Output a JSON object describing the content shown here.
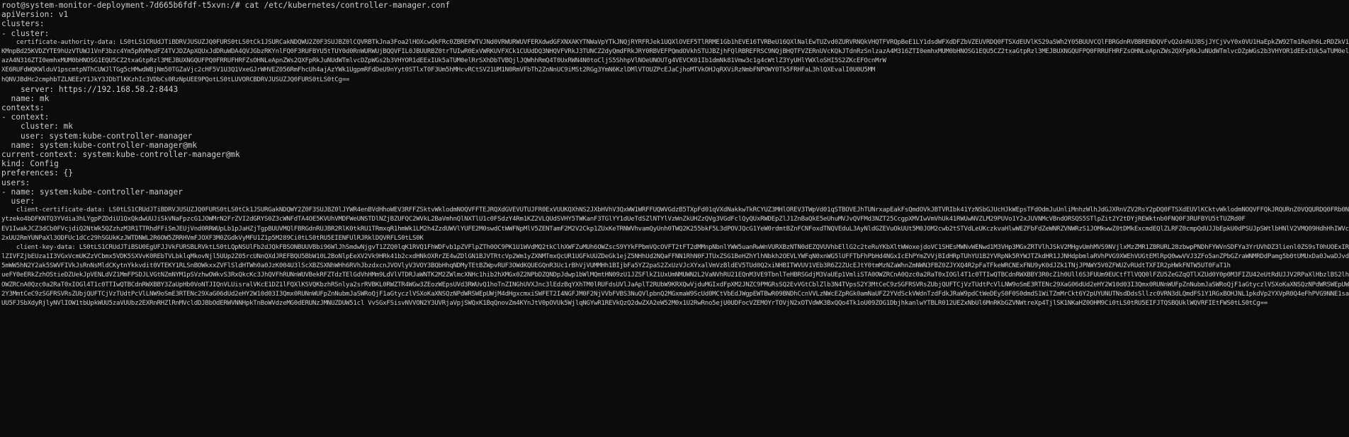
{
  "terminal": {
    "lines": [
      {
        "text": "root@system-monitor-deployment-7d665b6fdf-t5xvn:/# cat /etc/kubernetes/controller-manager.conf"
      },
      {
        "text": "apiVersion: v1"
      },
      {
        "text": "clusters:"
      },
      {
        "text": "- cluster:"
      },
      {
        "blob": true,
        "text": "    certificate-authority-data: LS0tLS1CRUdJTiBDRVJUSUZJQ0FURS0tLS0tCk1JSURCakNDQWU2Z0F3SUJBZ0lCQVRBTkJna3Foa2lHOXcwQkFRc0ZBREFWTVJNd0VRWURWUVFERXdwdGFXNXAKYTNWaVpYTkJNQjRYRFRJek1UQXlOVEF5TlRRME1Gb1hEVE16TVRBeU16QXlNalEwTUZvd0ZURVRNQkVHQTFVRQpBeE1LY1dsdWFXdDFZbVZEUVRDQ0FTSXdEUVlKS29aSWh2Y05BUUVCQlFBRGdnRVBBRENDQVFvQ2dnRUJBSjJYCjVvY0x0VU1HaEpkZW92Tm1ReUh6LzRDZkV1ejcwZEtveUlETENDazVkV09nY05zb2c5K1M2RCtHNlBMZUFRRk1UKV0NMV29icUVGREx0amtvSVEzSWRyV1loUkpzWXdOdU1uOWQ0eWxyS05RVXIwbm1kdVAzd2ZJS3BvMHpNdi9NZ"
      },
      {
        "blob": true,
        "text": "KMnpBd25KVDZYTE9hUzVTUWJ1VnF3bzc4Ym5pRVMvdFZ4TVJDZApXQUxJdDRuWDA4QVJGbzRKYnlFQ0F3RUFBYU5tTUY0d0RnWURWUjBQQVFIL0JBUURBZ0trTUIwR0ExVWRKUVFXCk1CUUdDQ3NHQVFVRkJ3TUNCZ2dyQmdFRkJRY0RBVEFPQmdOVkhSTUJBZjhFQlRBREFRSC9NQjBHQTFVZERnUVcKQkJTdnRzSnlzazA4M316ZTI0emhxMUM0bHNOSG1EQU5CZ2txaGtpRzl3MEJBUXNGQUFPQ0FRRUFHRFZsOHNLeApnZWs2QXFpRkJuNUdWTmlvcDZpWGs2b3VHYOR1dEExIUk5aTUM0elRrSXhDbTVBQjlJQWhhRmQ4T0UxRWN4N0toCljIjRnQ2dWN0toCl"
      },
      {
        "blob": true,
        "text": "azA4N316ZTI0emhxMUM0bHNOSG1EQU5CZ2txaGtpRzl3MEJBUXNGQUFPQ0FRRUFHRFZsOHNLeApnZWs2QXFpRkJuNUdWTmlvcDZpWGs2b3VHYOR1dEExIUk5aTUM0elRrSXhDbTVBQjlJQWhhRmQ4T0UxRWN4N0toCljS5ShhpVlNOeUNOUTg4VEVCK01Ib1dmNk81Vmw3c1g4cWtlZ3YyUHlYWXloSHI5S2ZKcEFOcnMrW"
      },
      {
        "blob": true,
        "text": "XE6RUFdWQKWlduV1pscmtpNThCUWJlTGg5cHMwdWBjNm50TGZaVjc2cHF5V1U3Q1VxeGJrWHVEZ056RmFhcUh4ajAzYWk1UgpmRFdDeU9nYyt0STlxT0F3Um5hMHcvRCtSV21UM1N0RmVFbTh2ZnNnUC9iMSt2RGg3YmN6KzlDMlVTOUZPcEJaCjhoMTVkOHJqRXViRzNmbFNPOWY0Tk5FRHFaL3hlQXEvalI0U0U5MM"
      },
      {
        "blob": true,
        "text": "hQNVJBdHc2cmphbTZLNEEzY1JkY3JDbTlKKzhIc3VDbCs0RzNpUEE9PQotLS0tLUVORCBDRVJUSUZJQ0FURS0tLS0tCg=="
      },
      {
        "text": "    server: https://192.168.58.2:8443"
      },
      {
        "text": "  name: mk"
      },
      {
        "text": "contexts:"
      },
      {
        "text": "- context:"
      },
      {
        "text": "    cluster: mk"
      },
      {
        "text": "    user: system:kube-controller-manager"
      },
      {
        "text": "  name: system:kube-controller-manager@mk"
      },
      {
        "text": "current-context: system:kube-controller-manager@mk"
      },
      {
        "text": "kind: Config"
      },
      {
        "text": "preferences: {}"
      },
      {
        "text": "users:"
      },
      {
        "text": "- name: system:kube-controller-manager"
      },
      {
        "text": "  user:"
      },
      {
        "blob": true,
        "text": "    client-certificate-data: LS0tLS1CRUdJTiBDRVJUSUZJQ0FURS0tLS0tCk1JSURGakNDQWY2Z0F3SUJBZ0lJYWR4enBVdHhoWEV3RFFZSktvWklodmNOQVFFTEJRQXdGVEVUTUJFR0ExVUUKQXhNS2JXbHVhV3QxWW1WRFFUQWVGdzB5TXpFd01qVXdNakkwTkRCYUZ3MHlOREV3TWpVd01qSTBOVEJhTUNrxapEakFsQmdOVkJBTVRIbk41YzNSbGJUcHJkWEpsTFdOdmJuUnliMnhzWlhJdGJXRnVZV2RsY2pDQ0FTSXdEUVlKCktvWklodmNOQVFFQkJRQURnZ0VQQURDQ0FRb0NnZ0VCQUovcWJ2ZVI4TFhWeUFMVnpWNzZlK2lvWndkekpNQjN6VVBkSUN2"
      },
      {
        "blob": true,
        "text": "ytzeko4bDFKNTQ3YVdia3hLYgpPZDdiU1QxQkdwUUJiSkVNaFpzcG1JOWMrN2FrZVI2dGRYS0Z3cWNFdTA4OE5KVUhVMDFWeUNSTDlNZjBZUFQC2WVkL2BaVmhnQlNXTlU1c0FSdzY4Rm1KZ2VLQUdSVHY5TWKanF3TGlYY1dUeTdSZlNTYlVzWnZkUHZzQVg3VGdFclQyQUxRWDEpZlJ1ZnBaQkE5eUhuMVJvQVFMd3NZT25CcgpXMVIwVmVhUk41RWUwNVZLM29PUVo1Y2xJUVNMcVBndORSQS5STlpZit2Y2tDYjREWktnb0FNQ0F3RUFBYU5tTUZRd0F"
      },
      {
        "blob": true,
        "text": "EV1IwakJCZ3dCb0FVcjdiQ2NtWk5QZzhzM3R1TTRhdFFiSmJEUjVnd0RRWUpLb1pJaHZjTgpBUUVMQlFBRGdnRUJBR2RlK0tkRU1TRmxqR1hmWk1LM2h4ZzdUWVlYUFE2M0swdCtWWFNpMlV5ZENTamF2M2V2Ckp1ZUxKeTRNWVhvamQyUnh0TWQ2K255bkF5L3dPOVJQcG1YeW0rdmtBZnFCNFoxdTNQVEduL3AyNldGZEVuOkUUt5M0JOM2cwb2tSTVdLeUKczkvaHlwWEZFbFdZeWNRZVNWRzS1JOMkwwZ0tDMkExcmdEQlZLRFZ0cmpQdUJJbEpkU0dPSUJpSWtlbHNlV2VMQ09HdhHhIWVc5VFBvaGNTL2xsNHlEeiZDZFIzSnBxSmdwQlRJRkd"
      },
      {
        "blob": true,
        "text": "2xUU2RmYUNPaXl3ODFUc1dCc29hSGUkKzJWTDNWL2R6OW5ZRRHVmFJOXF3M0ZGdkVyMFU1Z1p5M289Ci0tLS0tRU5EIENFUlRJRklDQVRFLS0tLS0K"
      },
      {
        "blob": true,
        "text": "    client-key-data: LS0tLS1CRUdJTiBSU0EgUFJJVkFURSBLRVktLS0tLQpNSUlFb2dJQkFBSONBUUVBbi96WlJhSmdwNjgvT1ZZQ0lqK1RVQ1FhWDFvb1pZVFlpZTh0OC9PK1U1WVdMQ2tkClhXWFZuMUh6OWZscS9YYkFPbmVQcOVFT2tFT2dMMnpNbnlYWW5uanRwWnVURXBzNTN0dEZQVUVhbEllG2c2teRuYKbXltWWoxejdoVC1SHEsMWNvWENwd1M3VHp3MGxZRTVlhJSkV2MHgvUmhMVS9NVjlxMzZMR1ZBRURL28zbwpPNDhFYWVnSDFYa3YrUVhDZ3lienl0ZS9sT0hUOExIR2E2MnNJdFpOTlYzaXpEMENPdFJEaE5mZVVFRE3bTVuYVNhZEVwwwNnlUaXdsNEVNUWNNQXN3RDZrUTNvL3ZUOFQwUDhJT1lqcnRrTWdaSElOUGU0RVhERUQ"
      },
      {
        "blob": true,
        "text": "lZIVFZjbEUza1I3VGxVcmUKZzVCbmx5VDK5SXVvK0REbTVLbklqMkovNjl5UUp2Z05rcUNnQXdJREFBQU5BbW10L2BoNlpEeXV2Vk9HRk41b2cxdHNkOXRrZE4wZDlGN1BJVTRtcVp2Wm1yZXNMTmxQcUR1UGFkUUZDeGk1ejZ5NHhUd2NQaFFNN1RhN0FJTUxZSG1BeHZhYlhNbkh2OEVLYWFqN0xnWG5lUFFTbFhPbHd4NGxIcEhPYmZVVjBIdHRpTUhYU1B2YVRpNk5RYWJTZkdHR1JJNHdpbmlaRVhPVG9XWEhVUGtEMlRpQ0wwVVJ3ZFo5anZPbGZraWNMRDdPamg5b0tUMUxDa0JwaDJvdkdqR3JPRGJKQjVnMUJTcXBTZk1BSGRpVGJmM0NPc"
      },
      {
        "blob": true,
        "text": "5mWW5hN2Y2ak5SWVFIVkJsRnNsMldCKytnYkkvdit0VTEKY1RLSnBOWkxxZVFlSldHTWh0a0JzK004U3lScXBZSXNhWHh6RVhJbzdxcnJVOVlyV3VOY3BQbHhqNDMyTEtBZWpvRUF3OWdKQUEGQnR3Uc1rBhVjVUMMHh1BIjbFa5YZ2paS2ZxUzVJcXYxalVmVzBldEV5TUd0Q2xiNHBITWVUV1VEb3R6Z2ZUcEJtY0tmMzNZaWhnZmNWN3FBZ0ZJYXQ4R2pFaTFkeWRCNExFNU9yK0dJZk1TNjJPNWY5V0ZFWUZvRUdtTXFIR2pHWkFNTW5UT0FaT1h"
      },
      {
        "blob": true,
        "text": "ueFY0eERkZzhOStieDZUekJpVENLdVZ1MmFPSDJLVGtNZmNYM1pSVzhwOWkvS3RxQkcKc3JhQVFhRUNnWUVBekRFZTdzTElGdVhHMm9LdVlVTDRJaWNTK2M2ZWlmcXNHc1hib2hXMGx0Z2NPbDZQNDpJdwp1bWlMQmtHN09zU1JZSFlkZ1UxUmNMUWN2L2VaNVhRU21EQnM3VE9TbnlTeHBRSGdjM3VaUEp1VmliSTA0OWZRCnA0Qzc0a2RaT0xIOGl4T1c0TTIwQTBCdnRWXBBY3R0cZ1h0Ull6S3FUUm9EUCtfTlVQQ0lFZU5ZeGZqQTlXZUd0Y0p0M3FIZU42eUtRdUJJV2RPaXlHbzlBS2lhNS9HQmRWRHpTQ0F3RVdDWUd"
      },
      {
        "blob": true,
        "text": "OWZRCnA0Qzc0a2RaT0xIOGl4T1c0TTIwQTBCdnRWXBBY3ZaUpHb0VoNTJIQnVLUisralVKcE1DZ1lFQXlKSVQKbzhRSnlya2srRVBKL0RWZTR4WGw3ZEozWEpsUVd3RWUvQ1hoTnZINGhUVXJnc3lEdzBqYXhTM0lRUFdsUVlJaAplT2RUbW9KRXQwVjduMGIxdFpXM2JNZC9PMGRsSQ2EvVGtCblZlb3N4TVpsS2Y3MtCeC9zSGFRSVRsZUbjQUFTCjVzTUdtPcVlLNW9oSmE3RTENc29XaG06dUd2eHY2W10d03I3Qmx0RUNnWUFpZnNubmJaSWRoQjF1aGtyczlVSXoKaXNSQzNPdWRSWEpUWjM4dHgxcmxiSWFET2I4NGFJM0F2NjVVbFVBS3NuQVlpbnQ2"
      },
      {
        "blob": true,
        "text": "2Y3MmtCeC9zSGFRSVRsZUbjQUFTCjVzTUdtPcVlLNW9oSmE3RTENc29XaG06dUd2eHY2W10d03I3Qmx0RUNnWUFpZnNubmJaSWRoQjF1aGtyczlVSXoKaXNSQzNPdWRSWEpUWjM4dHgxcmxiSWFET2I4NGFJM0F2NjVVbFVBS3NuQVlpbnQ2MGxmaW9ScUd0MCtVbEdJWgpEWTBwR09BNDhCcnVVLzNWcEZpRGk0amNaUFZ2YVdSckVWdnTzdFdkJRaW9pdCtWeDEyS0F0S0dmdS1WiTZmMrCkt6Y2pUYUNUTNsdDdsSllzc0VRN3dLQmdFS1Y1RGxBOHJNL1pkdVp2YXVpR0Q4eFhPVG9NNE1sajd5MmtZL0dsLzRDRI1Tep5TXA5SzVHZ1JQSzE2bnFBUDZDl1TN2FyaXhiUDZzQkdpWDZlc1JJOHJjcFZHLzk3NEYvQ"
      },
      {
        "blob": true,
        "text": "UU5FJSbXdyRjlyNVlIOW1tbUpkWUU5zaVUUbz2EXRnRHZlRnMVcldDJBbOdERWVNNHpkTnBoWVdzeMG0dERUNzJMNUZDUW51cl VvSGxFSisvNVVON2Y3UVRjaVpjSWQxK1BqQnovZm4KYnJtV0pOVUk5WjlqNGYwR1REVkQzQ2dwZXA2eW52M0x1U2RwRno5ejU0UDFocVZEMOYrTOVjN2xOTVdWK3BxQQo4Tk1oU09ZOG1DbjhkanlwYTBLR012UEZxNbUl6MnRKbGZVNWtreXp4TjlSK1NKaHZ0OHM9Ci0tLS0tRU5EIFJTQSBQUklWQVRFIEtFWS0tLS0tCg=="
      }
    ]
  }
}
